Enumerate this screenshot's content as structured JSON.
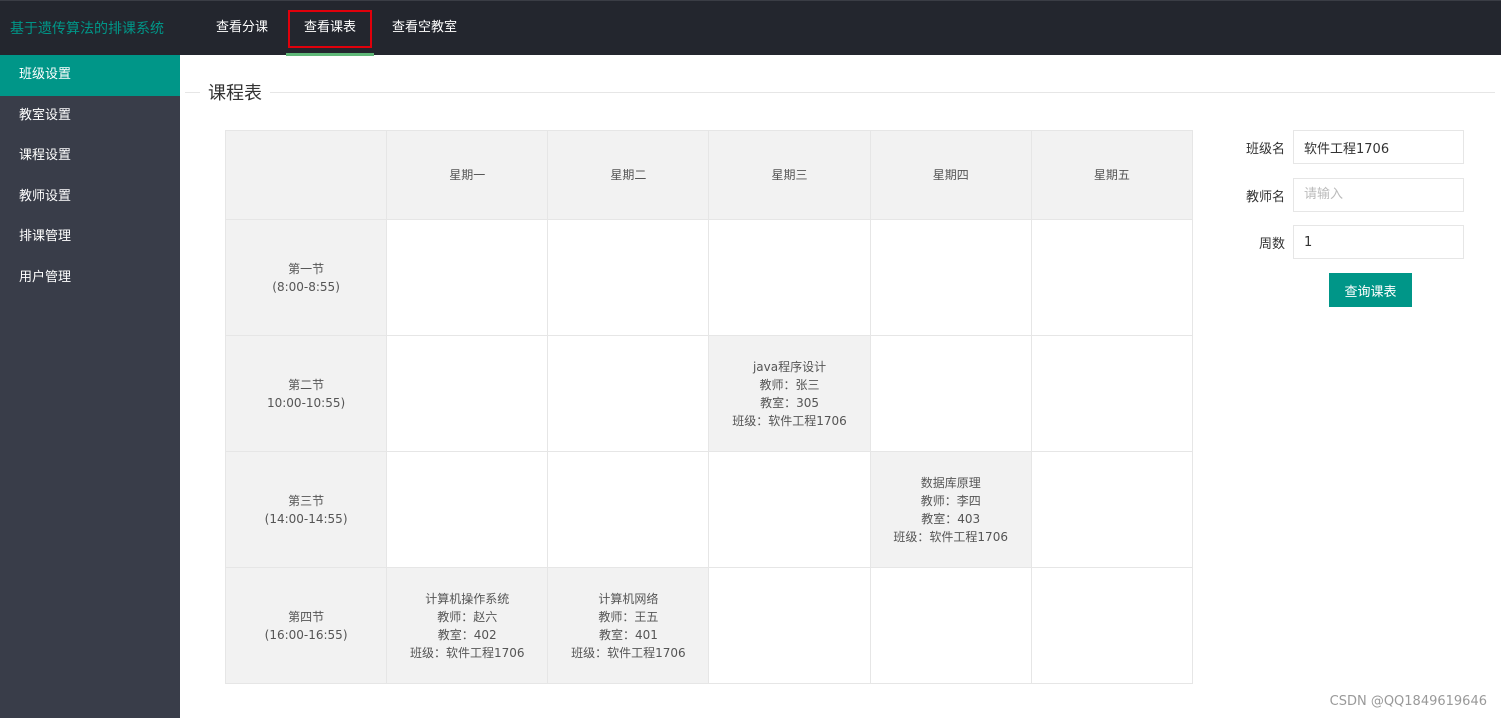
{
  "header": {
    "app_title": "基于遗传算法的排课系统",
    "nav": [
      {
        "label": "查看分课"
      },
      {
        "label": "查看课表"
      },
      {
        "label": "查看空教室"
      }
    ]
  },
  "sidebar": {
    "items": [
      {
        "label": "班级设置"
      },
      {
        "label": "教室设置"
      },
      {
        "label": "课程设置"
      },
      {
        "label": "教师设置"
      },
      {
        "label": "排课管理"
      },
      {
        "label": "用户管理"
      }
    ]
  },
  "main": {
    "section_title": "课程表"
  },
  "timetable": {
    "days": [
      "星期一",
      "星期二",
      "星期三",
      "星期四",
      "星期五"
    ],
    "periods": [
      {
        "name": "第一节",
        "time": "(8:00-8:55)"
      },
      {
        "name": "第二节",
        "time": "10:00-10:55)"
      },
      {
        "name": "第三节",
        "time": "(14:00-14:55)"
      },
      {
        "name": "第四节",
        "time": "(16:00-16:55)"
      }
    ],
    "cells": [
      [
        null,
        null,
        null,
        null,
        null
      ],
      [
        null,
        null,
        {
          "course": "java程序设计",
          "teacher": "教师：张三",
          "room": "教室：305",
          "class": "班级：软件工程1706"
        },
        null,
        null
      ],
      [
        null,
        null,
        null,
        {
          "course": "数据库原理",
          "teacher": "教师：李四",
          "room": "教室：403",
          "class": "班级：软件工程1706"
        },
        null
      ],
      [
        {
          "course": "计算机操作系统",
          "teacher": "教师：赵六",
          "room": "教室：402",
          "class": "班级：软件工程1706"
        },
        {
          "course": "计算机网络",
          "teacher": "教师：王五",
          "room": "教室：401",
          "class": "班级：软件工程1706"
        },
        null,
        null,
        null
      ]
    ]
  },
  "query_form": {
    "class_label": "班级名",
    "class_value": "软件工程1706",
    "teacher_label": "教师名",
    "teacher_placeholder": "请输入",
    "week_label": "周数",
    "week_value": "1",
    "submit_label": "查询课表"
  },
  "watermark": "CSDN @QQ1849619646",
  "colors": {
    "header_bg": "#23262e",
    "sidebar_bg": "#393d49",
    "accent": "#009688",
    "nav_underline": "#5fb878",
    "highlight_border": "#e0000b"
  }
}
